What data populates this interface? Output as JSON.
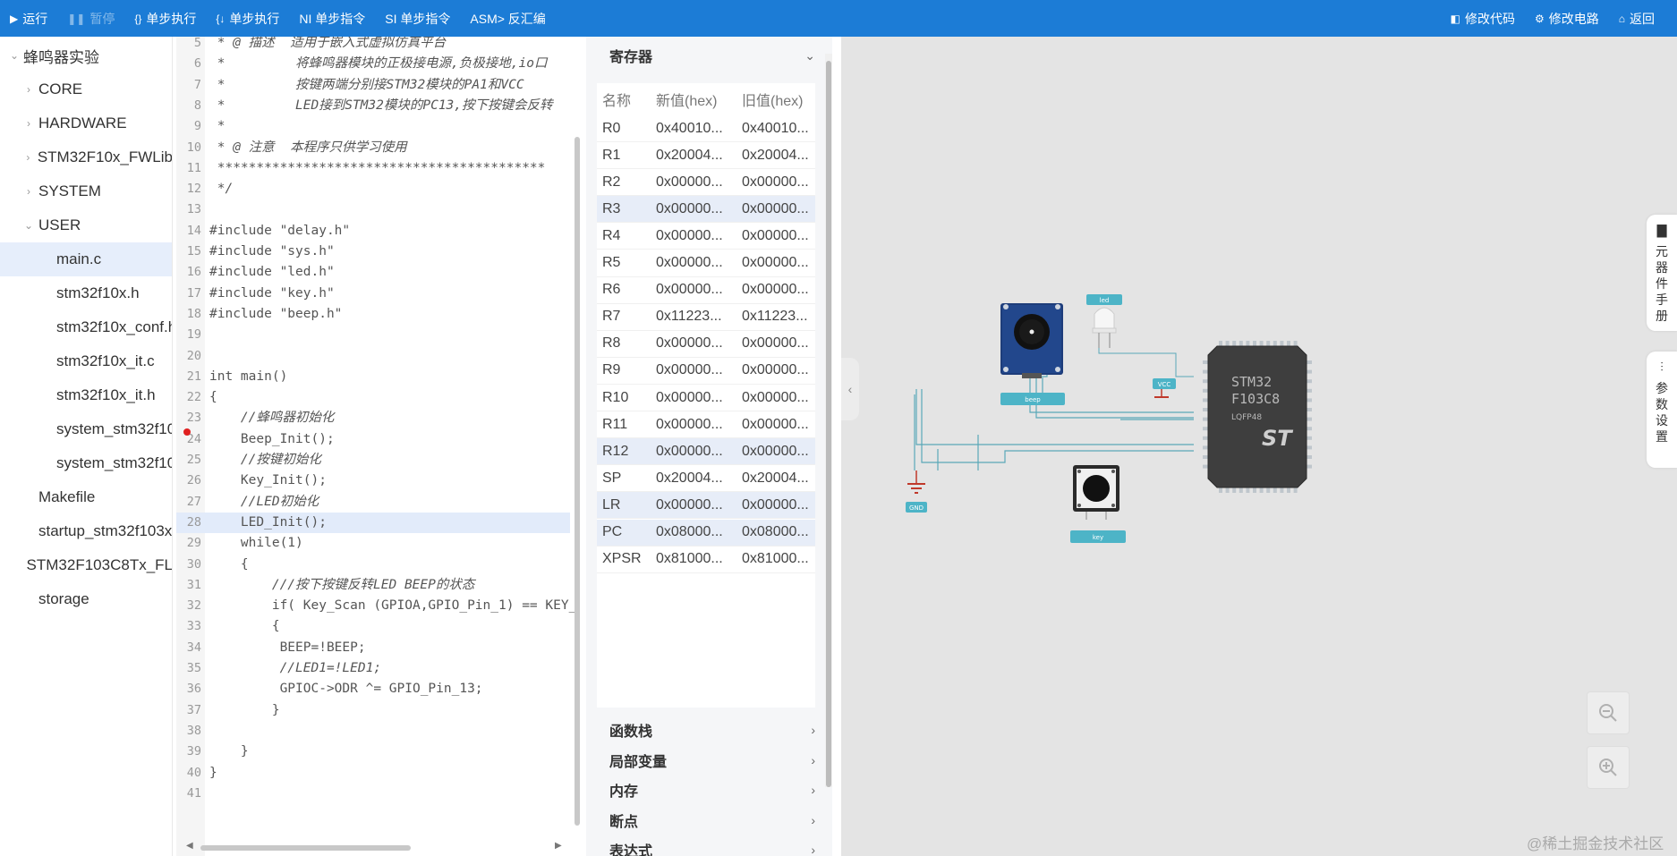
{
  "toolbar": {
    "run": "运行",
    "pause": "暂停",
    "step_over": "单步执行",
    "step_into": "单步执行",
    "ni": "NI 单步指令",
    "si": "SI 单步指令",
    "asm": "ASM> 反汇编",
    "edit_code": "修改代码",
    "edit_circuit": "修改电路",
    "back": "返回"
  },
  "tree": {
    "root": "蜂鸣器实验",
    "items": [
      {
        "label": "CORE",
        "level": 1,
        "folder": true
      },
      {
        "label": "HARDWARE",
        "level": 1,
        "folder": true
      },
      {
        "label": "STM32F10x_FWLib",
        "level": 1,
        "folder": true
      },
      {
        "label": "SYSTEM",
        "level": 1,
        "folder": true
      },
      {
        "label": "USER",
        "level": 1,
        "folder": true,
        "open": true
      },
      {
        "label": "main.c",
        "level": 2,
        "selected": true
      },
      {
        "label": "stm32f10x.h",
        "level": 2
      },
      {
        "label": "stm32f10x_conf.h",
        "level": 2
      },
      {
        "label": "stm32f10x_it.c",
        "level": 2
      },
      {
        "label": "stm32f10x_it.h",
        "level": 2
      },
      {
        "label": "system_stm32f10",
        "level": 2
      },
      {
        "label": "system_stm32f10",
        "level": 2
      },
      {
        "label": "Makefile",
        "level": 1
      },
      {
        "label": "startup_stm32f103x",
        "level": 1
      },
      {
        "label": "STM32F103C8Tx_FL",
        "level": 1
      },
      {
        "label": "storage",
        "level": 1
      }
    ]
  },
  "code": {
    "lines": [
      {
        "n": "5",
        "t": " * @ 描述  适用于嵌入式虚拟仿真平台"
      },
      {
        "n": "6",
        "t": " *         将蜂鸣器模块的正极接电源,负极接地,io口"
      },
      {
        "n": "7",
        "t": " *         按键两端分别接STM32模块的PA1和VCC"
      },
      {
        "n": "8",
        "t": " *         LED接到STM32模块的PC13,按下按键会反转"
      },
      {
        "n": "9",
        "t": " *"
      },
      {
        "n": "10",
        "t": " * @ 注意  本程序只供学习使用"
      },
      {
        "n": "11",
        "t": " ******************************************"
      },
      {
        "n": "12",
        "t": " */"
      },
      {
        "n": "13",
        "t": ""
      },
      {
        "n": "14",
        "t": "#include \"delay.h\""
      },
      {
        "n": "15",
        "t": "#include \"sys.h\""
      },
      {
        "n": "16",
        "t": "#include \"led.h\""
      },
      {
        "n": "17",
        "t": "#include \"key.h\""
      },
      {
        "n": "18",
        "t": "#include \"beep.h\""
      },
      {
        "n": "19",
        "t": ""
      },
      {
        "n": "20",
        "t": ""
      },
      {
        "n": "21",
        "t": "int main()"
      },
      {
        "n": "22",
        "t": "{"
      },
      {
        "n": "23",
        "t": "    //蜂鸣器初始化"
      },
      {
        "n": "24",
        "t": "    Beep_Init();"
      },
      {
        "n": "25",
        "t": "    //按键初始化"
      },
      {
        "n": "26",
        "t": "    Key_Init();"
      },
      {
        "n": "27",
        "t": "    //LED初始化"
      },
      {
        "n": "28",
        "t": "    LED_Init();"
      },
      {
        "n": "29",
        "t": "    while(1)"
      },
      {
        "n": "30",
        "t": "    {"
      },
      {
        "n": "31",
        "t": "        ///按下按键反转LED BEEP的状态"
      },
      {
        "n": "32",
        "t": "        if( Key_Scan (GPIOA,GPIO_Pin_1) == KEY_"
      },
      {
        "n": "33",
        "t": "        {"
      },
      {
        "n": "34",
        "t": "         BEEP=!BEEP;"
      },
      {
        "n": "35",
        "t": "         //LED1=!LED1;"
      },
      {
        "n": "36",
        "t": "         GPIOC->ODR ^= GPIO_Pin_13;"
      },
      {
        "n": "37",
        "t": "        }"
      },
      {
        "n": "38",
        "t": ""
      },
      {
        "n": "39",
        "t": "    }"
      },
      {
        "n": "40",
        "t": "}"
      },
      {
        "n": "41",
        "t": ""
      }
    ],
    "highlight_line": "28",
    "breakpoint_line": "24"
  },
  "registers": {
    "title": "寄存器",
    "headers": [
      "名称",
      "新值(hex)",
      "旧值(hex)"
    ],
    "rows": [
      {
        "name": "R0",
        "new": "0x40010...",
        "old": "0x40010...",
        "changed": false
      },
      {
        "name": "R1",
        "new": "0x20004...",
        "old": "0x20004...",
        "changed": false
      },
      {
        "name": "R2",
        "new": "0x00000...",
        "old": "0x00000...",
        "changed": false
      },
      {
        "name": "R3",
        "new": "0x00000...",
        "old": "0x00000...",
        "changed": true
      },
      {
        "name": "R4",
        "new": "0x00000...",
        "old": "0x00000...",
        "changed": false
      },
      {
        "name": "R5",
        "new": "0x00000...",
        "old": "0x00000...",
        "changed": false
      },
      {
        "name": "R6",
        "new": "0x00000...",
        "old": "0x00000...",
        "changed": false
      },
      {
        "name": "R7",
        "new": "0x11223...",
        "old": "0x11223...",
        "changed": false
      },
      {
        "name": "R8",
        "new": "0x00000...",
        "old": "0x00000...",
        "changed": false
      },
      {
        "name": "R9",
        "new": "0x00000...",
        "old": "0x00000...",
        "changed": false
      },
      {
        "name": "R10",
        "new": "0x00000...",
        "old": "0x00000...",
        "changed": false
      },
      {
        "name": "R11",
        "new": "0x00000...",
        "old": "0x00000...",
        "changed": false
      },
      {
        "name": "R12",
        "new": "0x00000...",
        "old": "0x00000...",
        "changed": true
      },
      {
        "name": "SP",
        "new": "0x20004...",
        "old": "0x20004...",
        "changed": false
      },
      {
        "name": "LR",
        "new": "0x00000...",
        "old": "0x00000...",
        "changed": true
      },
      {
        "name": "PC",
        "new": "0x08000...",
        "old": "0x08000...",
        "changed": true
      },
      {
        "name": "XPSR",
        "new": "0x81000...",
        "old": "0x81000...",
        "changed": false
      }
    ]
  },
  "sections": [
    "函数栈",
    "局部变量",
    "内存",
    "断点",
    "表达式"
  ],
  "circuit": {
    "chip_line1": "STM32",
    "chip_line2": "F103C8",
    "chip_line3": "LQFP48",
    "chip_logo": "ST",
    "beep_label": "beep",
    "led_label": "led",
    "vcc_label": "VCC",
    "gnd_label": "GND",
    "key_label": "key"
  },
  "sidetabs": {
    "manual": "元器件手册",
    "params": "参数设置"
  },
  "watermark": "@稀土掘金技术社区"
}
